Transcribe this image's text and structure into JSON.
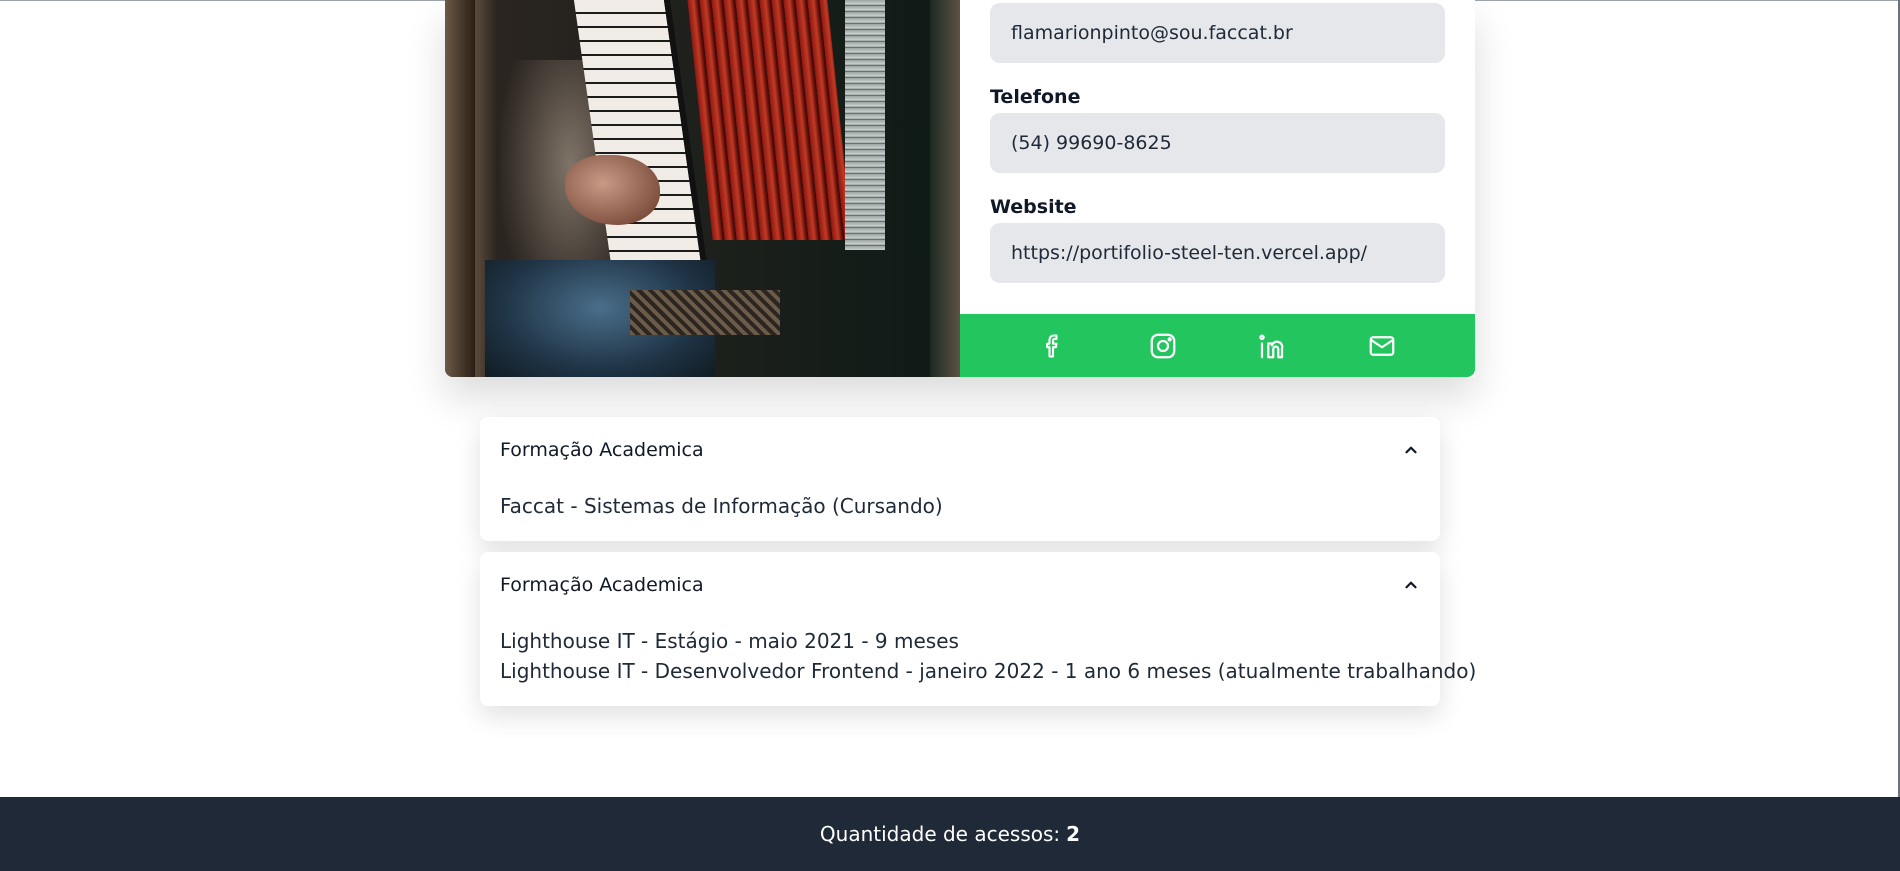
{
  "profile": {
    "email": "flamarionpinto@sou.faccat.br",
    "phone_label": "Telefone",
    "phone": "(54) 99690-8625",
    "website_label": "Website",
    "website": "https://portifolio-steel-ten.vercel.app/",
    "photo_icon": "accordion-player-photo"
  },
  "social": {
    "color": "#22c55e",
    "icons": [
      "facebook-icon",
      "instagram-icon",
      "linkedin-icon",
      "mail-icon"
    ]
  },
  "sections": [
    {
      "title": "Formação Academica",
      "items": [
        "Faccat - Sistemas de Informação (Cursando)"
      ]
    },
    {
      "title": "Formação Academica",
      "items": [
        "Lighthouse IT - Estágio - maio 2021 - 9 meses",
        "Lighthouse IT - Desenvolvedor Frontend - janeiro 2022 - 1 ano 6 meses (atualmente trabalhando)"
      ]
    }
  ],
  "footer": {
    "label": "Quantidade de acessos:",
    "count": "2",
    "color": "#1f2937"
  }
}
